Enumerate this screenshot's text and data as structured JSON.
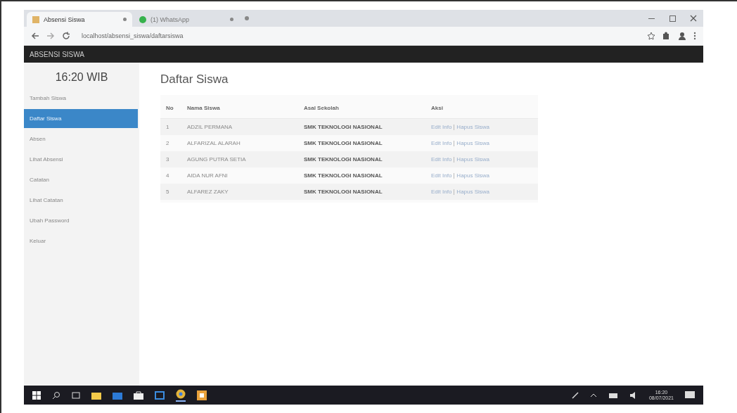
{
  "browser": {
    "tabs": [
      {
        "title": "Absensi Siswa",
        "selected": true
      },
      {
        "title": "(1) WhatsApp",
        "selected": false
      }
    ],
    "url": "localhost/absensi_siswa/daftarsiswa"
  },
  "app_title": "ABSENSI SISWA",
  "sidebar": {
    "clock": "16:20 WIB",
    "items": [
      {
        "label": "Tambah Siswa",
        "selected": false
      },
      {
        "label": "Daftar Siswa",
        "selected": true
      },
      {
        "label": "Absen",
        "selected": false
      },
      {
        "label": "Lihat Absensi",
        "selected": false
      },
      {
        "label": "Catatan",
        "selected": false
      },
      {
        "label": "Lihat Catatan",
        "selected": false
      },
      {
        "label": "Ubah Password",
        "selected": false
      },
      {
        "label": "Keluar",
        "selected": false
      }
    ]
  },
  "page_title": "Daftar Siswa",
  "table": {
    "columns": [
      "No",
      "Nama Siswa",
      "Asal Sekolah",
      "Aksi"
    ],
    "rows": [
      {
        "no": "1",
        "name": "ADZIL PERMANA",
        "school": "SMK TEKNOLOGI NASIONAL",
        "actions": [
          "Edit Info",
          "Hapus Siswa"
        ]
      },
      {
        "no": "2",
        "name": "ALFARIZAL ALARAH",
        "school": "SMK TEKNOLOGI NASIONAL",
        "actions": [
          "Edit Info",
          "Hapus Siswa"
        ]
      },
      {
        "no": "3",
        "name": "AGUNG PUTRA SETIA",
        "school": "SMK TEKNOLOGI NASIONAL",
        "actions": [
          "Edit Info",
          "Hapus Siswa"
        ]
      },
      {
        "no": "4",
        "name": "AIDA NUR AFNI",
        "school": "SMK TEKNOLOGI NASIONAL",
        "actions": [
          "Edit Info",
          "Hapus Siswa"
        ]
      },
      {
        "no": "5",
        "name": "ALFAREZ ZAKY",
        "school": "SMK TEKNOLOGI NASIONAL",
        "actions": [
          "Edit Info",
          "Hapus Siswa"
        ]
      }
    ]
  },
  "taskbar": {
    "time": "16:20",
    "date": "08/07/2021"
  }
}
